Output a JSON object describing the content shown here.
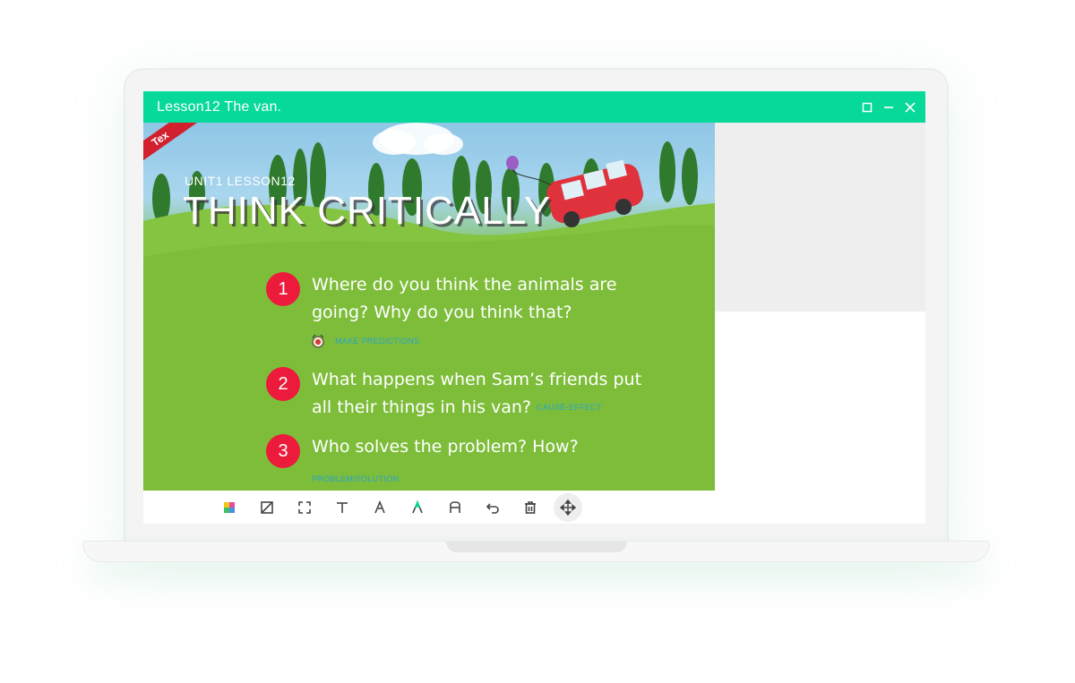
{
  "window": {
    "title": "Lesson12  The van."
  },
  "slide": {
    "ribbon_label": "Tex",
    "unit_label": "UNIT1  LESSON12",
    "heading": "THINK CRITICALLY",
    "questions": [
      {
        "number": "1",
        "text": "Where do you think the animals are going? Why do you think that?",
        "skill": "MAKE PREDICTIONS"
      },
      {
        "number": "2",
        "text": "What happens when Sam’s friends put all their things in his van?",
        "skill": "CAUSE-EFFECT"
      },
      {
        "number": "3",
        "text": "Who solves the problem? How?",
        "skill": "PROBLEM/SOLUTION"
      }
    ]
  },
  "toolbar": {
    "tools": [
      {
        "icon": "color-palette-icon"
      },
      {
        "icon": "crop-icon"
      },
      {
        "icon": "select-icon"
      },
      {
        "icon": "text-icon"
      },
      {
        "icon": "pen-icon"
      },
      {
        "icon": "highlighter-icon"
      },
      {
        "icon": "eraser-icon"
      },
      {
        "icon": "undo-icon"
      },
      {
        "icon": "delete-icon"
      },
      {
        "icon": "move-icon"
      }
    ]
  },
  "colors": {
    "titlebar": "#07d99a",
    "number_badge": "#ec1b3b",
    "skill_tag": "#2aa4c8"
  }
}
